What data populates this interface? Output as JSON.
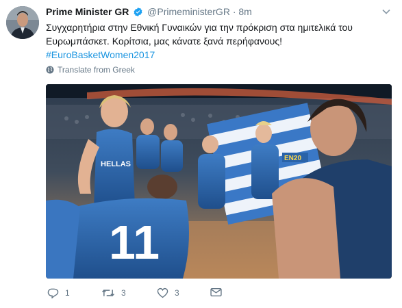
{
  "tweet": {
    "author_name": "Prime Minister GR",
    "handle": "@PrimeministerGR",
    "separator": "·",
    "time": "8m",
    "text_line1": "Συγχαρητήρια στην Εθνική Γυναικών για την πρόκριση στα ημιτελικά του",
    "text_line2": "Ευρωμπάσκετ. Κορίτσια, μας κάνατε ξανά περήφανους!",
    "hashtag": "#EuroBasketWomen2017",
    "translate_label": "Translate from Greek",
    "photo_jersey_text": "HELLAS",
    "photo_jersey_number": "11",
    "photo_banner_text": "EN20"
  },
  "actions": {
    "reply_count": "1",
    "retweet_count": "3",
    "like_count": "3"
  },
  "colors": {
    "link": "#1b95e0",
    "meta": "#657786",
    "verified": "#1da1f2",
    "jersey": "#2a63a8"
  }
}
